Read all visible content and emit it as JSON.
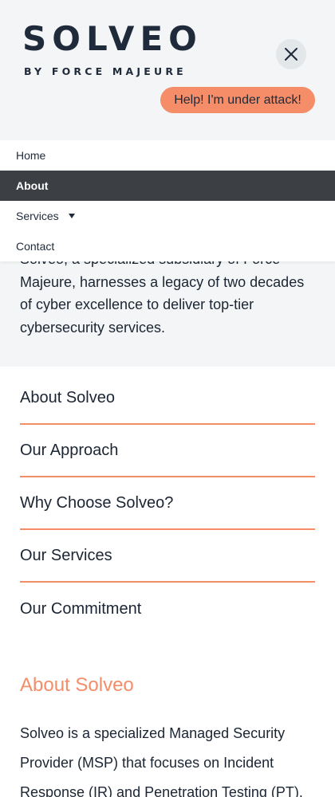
{
  "header": {
    "logo_main": "SOLVEO",
    "logo_sub": "BY FORCE MAJEURE",
    "close_icon": "close-icon",
    "attack_button": "Help! I'm under attack!",
    "accent_color": "#f48d68"
  },
  "nav": {
    "items": [
      {
        "label": "Home"
      },
      {
        "label": "About",
        "active": true
      },
      {
        "label": "Services",
        "has_dropdown": true
      },
      {
        "label": "Contact"
      }
    ]
  },
  "intro": {
    "text": "Solveo, a specialized subsidiary of Force Majeure, harnesses a legacy of two decades of cyber excellence to deliver top-tier cybersecurity services."
  },
  "accordion": {
    "items": [
      {
        "label": "About Solveo"
      },
      {
        "label": "Our Approach"
      },
      {
        "label": "Why Choose Solveo?"
      },
      {
        "label": "Our Services"
      },
      {
        "label": "Our Commitment"
      }
    ]
  },
  "section": {
    "title": "About Solveo",
    "body": "Solveo is a specialized Managed Security Provider (MSP) that focuses on Incident Response (IR) and Penetration Testing (PT)."
  }
}
